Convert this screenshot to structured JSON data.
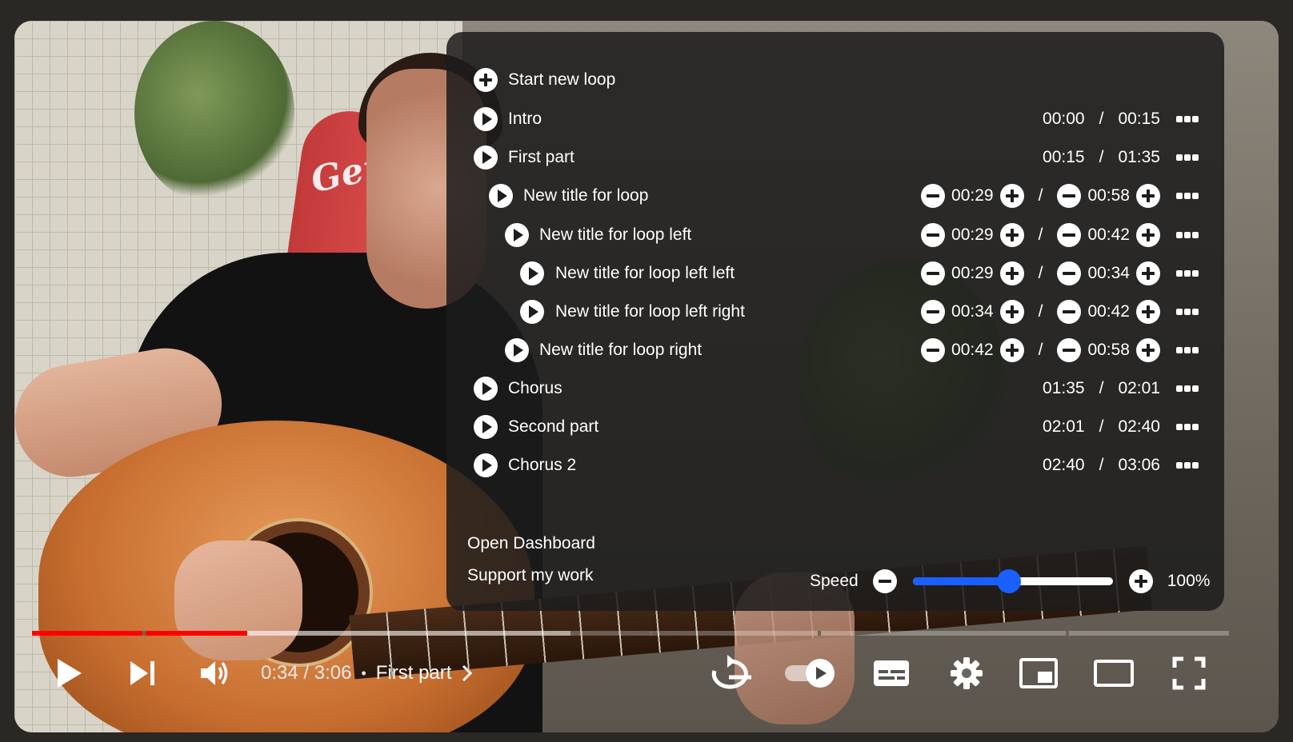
{
  "loop_panel": {
    "start_new_loop": "Start new loop",
    "loops": [
      {
        "title": "Intro",
        "start": "00:00",
        "end": "00:15"
      },
      {
        "title": "First part",
        "start": "00:15",
        "end": "01:35"
      },
      {
        "title": "New title for loop",
        "start": "00:29",
        "end": "00:58"
      },
      {
        "title": "New title for loop left",
        "start": "00:29",
        "end": "00:42"
      },
      {
        "title": "New title for loop left left",
        "start": "00:29",
        "end": "00:34"
      },
      {
        "title": "New title for loop left right",
        "start": "00:34",
        "end": "00:42"
      },
      {
        "title": "New title for loop right",
        "start": "00:42",
        "end": "00:58"
      },
      {
        "title": "Chorus",
        "start": "01:35",
        "end": "02:01"
      },
      {
        "title": "Second part",
        "start": "02:01",
        "end": "02:40"
      },
      {
        "title": "Chorus 2",
        "start": "02:40",
        "end": "03:06"
      }
    ],
    "separator": "/",
    "open_dashboard": "Open Dashboard",
    "support_my_work": "Support my work",
    "speed_label": "Speed",
    "speed_value": "100%",
    "speed_slider_fraction": 0.48
  },
  "video_scene": {
    "board_text": "Genie"
  },
  "player": {
    "current_time": "0:34",
    "duration": "3:06",
    "time_separator": " / ",
    "chapter_dot": "•",
    "chapter": "First part",
    "progress_played_fraction": 0.18,
    "progress_buffered_fraction": 0.45,
    "accent_color": "#ff0000",
    "icons": [
      "play-icon",
      "next-icon",
      "volume-icon",
      "loop-icon",
      "autoplay-toggle",
      "subtitles-icon",
      "settings-icon",
      "miniplayer-icon",
      "theater-icon",
      "fullscreen-icon"
    ]
  }
}
